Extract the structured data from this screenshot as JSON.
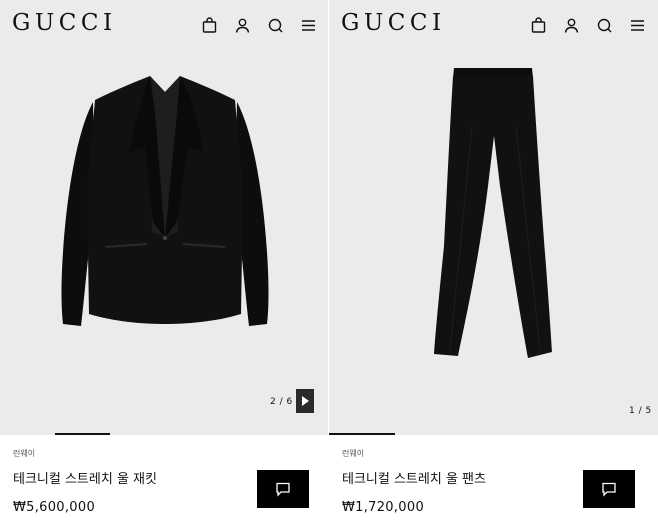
{
  "panels": [
    {
      "logo": "GUCCI",
      "pager": "2 / 6",
      "label": "런웨이",
      "name": "테크니컬 스트레치 울 재킷",
      "price": "₩5,600,000"
    },
    {
      "logo": "GUCCI",
      "pager": "1 / 5",
      "label": "런웨이",
      "name": "테크니컬 스트레치 울 팬츠",
      "price": "₩1,720,000"
    }
  ],
  "icons": [
    "shopping-bag-icon",
    "user-icon",
    "search-icon",
    "menu-icon"
  ],
  "colors": {
    "stage_bg": "#ebebeb",
    "text": "#111111",
    "button_bg": "#000000"
  }
}
